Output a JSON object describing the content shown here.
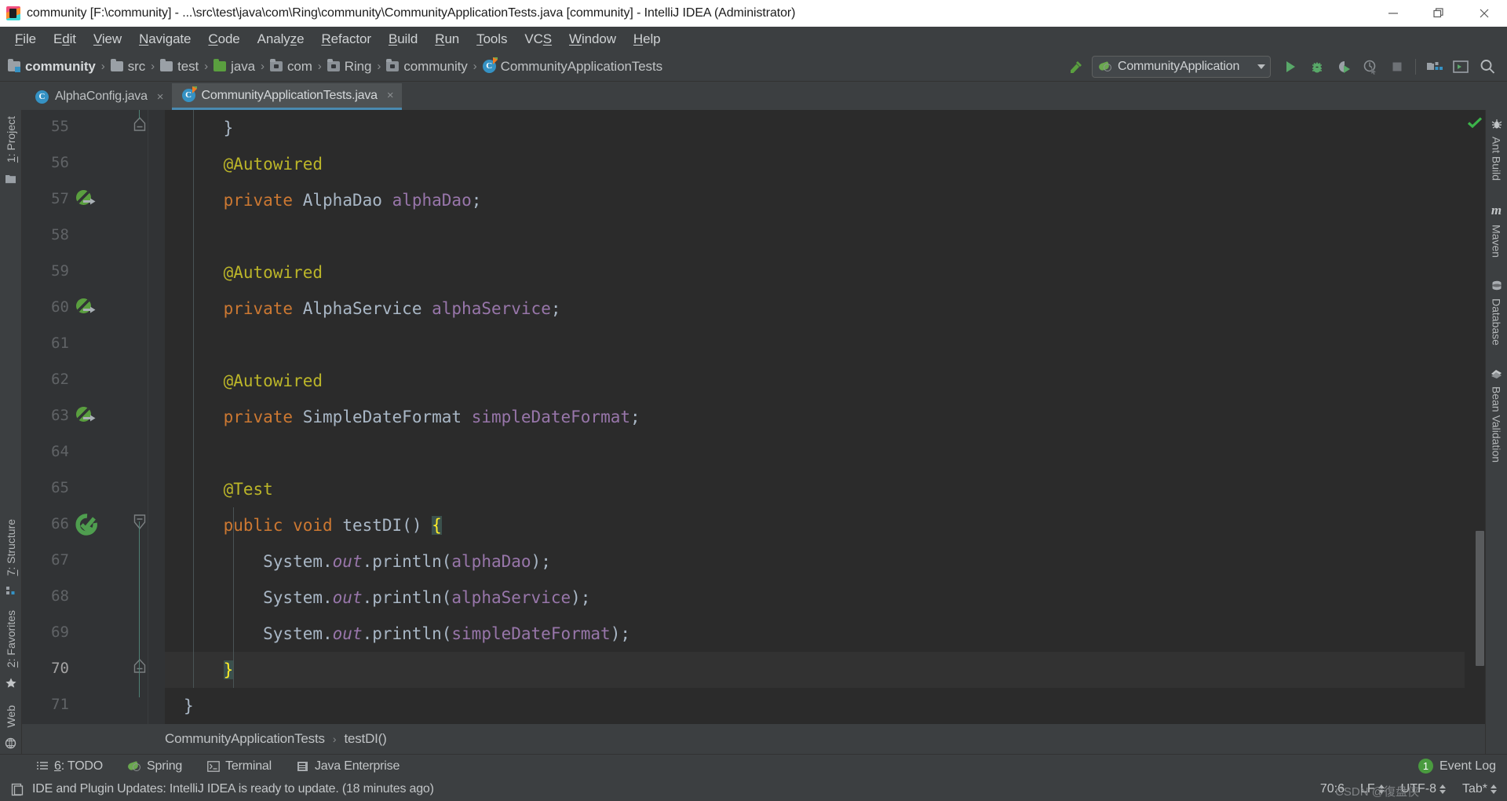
{
  "window": {
    "title": "community [F:\\community] - ...\\src\\test\\java\\com\\Ring\\community\\CommunityApplicationTests.java [community] - IntelliJ IDEA (Administrator)",
    "app_icon": "intellij-idea-icon",
    "minimize": "minimize-icon",
    "restore": "restore-icon",
    "close": "close-icon"
  },
  "menubar": {
    "items": [
      {
        "label": "File"
      },
      {
        "label": "Edit"
      },
      {
        "label": "View"
      },
      {
        "label": "Navigate"
      },
      {
        "label": "Code"
      },
      {
        "label": "Analyze"
      },
      {
        "label": "Refactor"
      },
      {
        "label": "Build"
      },
      {
        "label": "Run"
      },
      {
        "label": "Tools"
      },
      {
        "label": "VCS"
      },
      {
        "label": "Window"
      },
      {
        "label": "Help"
      }
    ]
  },
  "navbar": {
    "breadcrumbs": [
      {
        "label": "community",
        "icon": "project-folder-icon"
      },
      {
        "label": "src",
        "icon": "folder-icon"
      },
      {
        "label": "test",
        "icon": "folder-icon"
      },
      {
        "label": "java",
        "icon": "source-root-folder-icon"
      },
      {
        "label": "com",
        "icon": "package-icon"
      },
      {
        "label": "Ring",
        "icon": "package-icon"
      },
      {
        "label": "community",
        "icon": "package-icon"
      },
      {
        "label": "CommunityApplicationTests",
        "icon": "test-class-icon"
      }
    ],
    "separator": "›",
    "run_config": {
      "label": "CommunityApplication",
      "icon": "spring-boot-icon"
    },
    "toolbar": [
      {
        "name": "build-project-button",
        "icon": "hammer-icon"
      },
      {
        "name": "run-button",
        "icon": "run-icon"
      },
      {
        "name": "debug-button",
        "icon": "debug-icon"
      },
      {
        "name": "run-with-coverage-button",
        "icon": "coverage-icon"
      },
      {
        "name": "profiler-button",
        "icon": "profiler-icon"
      },
      {
        "name": "stop-button",
        "icon": "stop-icon"
      },
      {
        "name": "project-structure-button",
        "icon": "project-structure-icon"
      },
      {
        "name": "terminal-button",
        "icon": "terminal-icon"
      },
      {
        "name": "search-everywhere-button",
        "icon": "search-icon"
      }
    ]
  },
  "tabs": [
    {
      "label": "AlphaConfig.java",
      "icon": "java-class-icon",
      "active": false,
      "close": "×"
    },
    {
      "label": "CommunityApplicationTests.java",
      "icon": "java-test-class-icon",
      "active": true,
      "close": "×"
    }
  ],
  "left_strip": {
    "top": [
      {
        "label": "1: Project",
        "mnemonic": "1",
        "icon": "project-tool-icon"
      }
    ],
    "bottom": [
      {
        "label": "7: Structure",
        "mnemonic": "7",
        "icon": "structure-icon"
      },
      {
        "label": "2: Favorites",
        "mnemonic": "2",
        "icon": "star-icon"
      },
      {
        "label": "Web",
        "mnemonic": "",
        "icon": "web-icon"
      }
    ]
  },
  "right_strip": {
    "items": [
      {
        "label": "Ant Build",
        "icon": "ant-icon"
      },
      {
        "label": "Maven",
        "icon": "maven-icon"
      },
      {
        "label": "Database",
        "icon": "database-icon"
      },
      {
        "label": "Bean Validation",
        "icon": "bean-validation-icon"
      }
    ]
  },
  "editor": {
    "first_line_number": 55,
    "current_line": 70,
    "inspection_status": "ok-check-icon",
    "lines": [
      {
        "num": 55,
        "gutter": "",
        "fold": "fold-end",
        "tokens": [
          {
            "t": "    }",
            "c": "k-punc"
          }
        ]
      },
      {
        "num": 56,
        "gutter": "",
        "fold": "",
        "tokens": [
          {
            "t": "    @Autowired",
            "c": "k-ann"
          }
        ]
      },
      {
        "num": 57,
        "gutter": "spring-bean-icon",
        "fold": "",
        "tokens": [
          {
            "t": "    ",
            "c": "k-plain"
          },
          {
            "t": "private",
            "c": "k-kw"
          },
          {
            "t": " ",
            "c": "k-plain"
          },
          {
            "t": "AlphaDao",
            "c": "k-type"
          },
          {
            "t": " ",
            "c": "k-plain"
          },
          {
            "t": "alphaDao",
            "c": "k-field"
          },
          {
            "t": ";",
            "c": "k-punc"
          }
        ]
      },
      {
        "num": 58,
        "gutter": "",
        "fold": "",
        "tokens": [
          {
            "t": "",
            "c": "k-plain"
          }
        ]
      },
      {
        "num": 59,
        "gutter": "",
        "fold": "",
        "tokens": [
          {
            "t": "    @Autowired",
            "c": "k-ann"
          }
        ]
      },
      {
        "num": 60,
        "gutter": "spring-bean-icon",
        "fold": "",
        "tokens": [
          {
            "t": "    ",
            "c": "k-plain"
          },
          {
            "t": "private",
            "c": "k-kw"
          },
          {
            "t": " ",
            "c": "k-plain"
          },
          {
            "t": "AlphaService",
            "c": "k-type"
          },
          {
            "t": " ",
            "c": "k-plain"
          },
          {
            "t": "alphaService",
            "c": "k-field"
          },
          {
            "t": ";",
            "c": "k-punc"
          }
        ]
      },
      {
        "num": 61,
        "gutter": "",
        "fold": "",
        "tokens": [
          {
            "t": "",
            "c": "k-plain"
          }
        ]
      },
      {
        "num": 62,
        "gutter": "",
        "fold": "",
        "tokens": [
          {
            "t": "    @Autowired",
            "c": "k-ann"
          }
        ]
      },
      {
        "num": 63,
        "gutter": "spring-bean-icon",
        "fold": "",
        "tokens": [
          {
            "t": "    ",
            "c": "k-plain"
          },
          {
            "t": "private",
            "c": "k-kw"
          },
          {
            "t": " ",
            "c": "k-plain"
          },
          {
            "t": "SimpleDateFormat",
            "c": "k-type"
          },
          {
            "t": " ",
            "c": "k-plain"
          },
          {
            "t": "simpleDateFormat",
            "c": "k-field"
          },
          {
            "t": ";",
            "c": "k-punc"
          }
        ]
      },
      {
        "num": 64,
        "gutter": "",
        "fold": "",
        "tokens": [
          {
            "t": "",
            "c": "k-plain"
          }
        ]
      },
      {
        "num": 65,
        "gutter": "",
        "fold": "",
        "tokens": [
          {
            "t": "    @Test",
            "c": "k-ann"
          }
        ]
      },
      {
        "num": 66,
        "gutter": "run-test-icon",
        "fold": "fold-start",
        "tokens": [
          {
            "t": "    ",
            "c": "k-plain"
          },
          {
            "t": "public",
            "c": "k-kw"
          },
          {
            "t": " ",
            "c": "k-plain"
          },
          {
            "t": "void",
            "c": "k-kw"
          },
          {
            "t": " ",
            "c": "k-plain"
          },
          {
            "t": "testDI",
            "c": "k-plain"
          },
          {
            "t": "() ",
            "c": "k-punc"
          },
          {
            "t": "{",
            "c": "k-brace-hl"
          }
        ]
      },
      {
        "num": 67,
        "gutter": "",
        "fold": "",
        "tokens": [
          {
            "t": "        System.",
            "c": "k-plain"
          },
          {
            "t": "out",
            "c": "k-static-it"
          },
          {
            "t": ".println(",
            "c": "k-plain"
          },
          {
            "t": "alphaDao",
            "c": "k-field"
          },
          {
            "t": ");",
            "c": "k-punc"
          }
        ]
      },
      {
        "num": 68,
        "gutter": "",
        "fold": "",
        "tokens": [
          {
            "t": "        System.",
            "c": "k-plain"
          },
          {
            "t": "out",
            "c": "k-static-it"
          },
          {
            "t": ".println(",
            "c": "k-plain"
          },
          {
            "t": "alphaService",
            "c": "k-field"
          },
          {
            "t": ");",
            "c": "k-punc"
          }
        ]
      },
      {
        "num": 69,
        "gutter": "",
        "fold": "",
        "tokens": [
          {
            "t": "        System.",
            "c": "k-plain"
          },
          {
            "t": "out",
            "c": "k-static-it"
          },
          {
            "t": ".println(",
            "c": "k-plain"
          },
          {
            "t": "simpleDateFormat",
            "c": "k-field"
          },
          {
            "t": ");",
            "c": "k-punc"
          }
        ]
      },
      {
        "num": 70,
        "gutter": "",
        "fold": "fold-end",
        "current": true,
        "tokens": [
          {
            "t": "    ",
            "c": "k-plain"
          },
          {
            "t": "}",
            "c": "k-brace-hl"
          }
        ]
      },
      {
        "num": 71,
        "gutter": "",
        "fold": "",
        "tokens": [
          {
            "t": "}",
            "c": "k-punc"
          }
        ]
      }
    ],
    "breadcrumb": [
      {
        "label": "CommunityApplicationTests"
      },
      {
        "label": "testDI()"
      }
    ],
    "breadcrumb_sep": "›"
  },
  "toolwindow_bar": {
    "items": [
      {
        "label": "6: TODO",
        "mnemonic": "6",
        "icon": "todo-icon"
      },
      {
        "label": "Spring",
        "mnemonic": "",
        "icon": "spring-icon"
      },
      {
        "label": "Terminal",
        "mnemonic": "",
        "icon": "terminal-icon"
      },
      {
        "label": "Java Enterprise",
        "mnemonic": "",
        "icon": "java-enterprise-icon"
      }
    ],
    "event_log": {
      "label": "Event Log",
      "count": "1"
    }
  },
  "statusbar": {
    "message_icon": "notification-icon",
    "message": "IDE and Plugin Updates: IntelliJ IDEA is ready to update. (18 minutes ago)",
    "caret_position": "70:6",
    "line_separator": "LF",
    "encoding": "UTF-8",
    "indent": "Tab*",
    "watermark": "CSDN @復盘侠"
  },
  "colors": {
    "chrome": "#3c3f41",
    "editor_bg": "#2b2b2b",
    "gutter_bg": "#313335",
    "accent_blue": "#3592c4",
    "accent_green": "#4a9b3f",
    "annotation": "#bbb529",
    "keyword": "#cc7832",
    "field": "#9876aa",
    "text": "#a9b7c6"
  }
}
